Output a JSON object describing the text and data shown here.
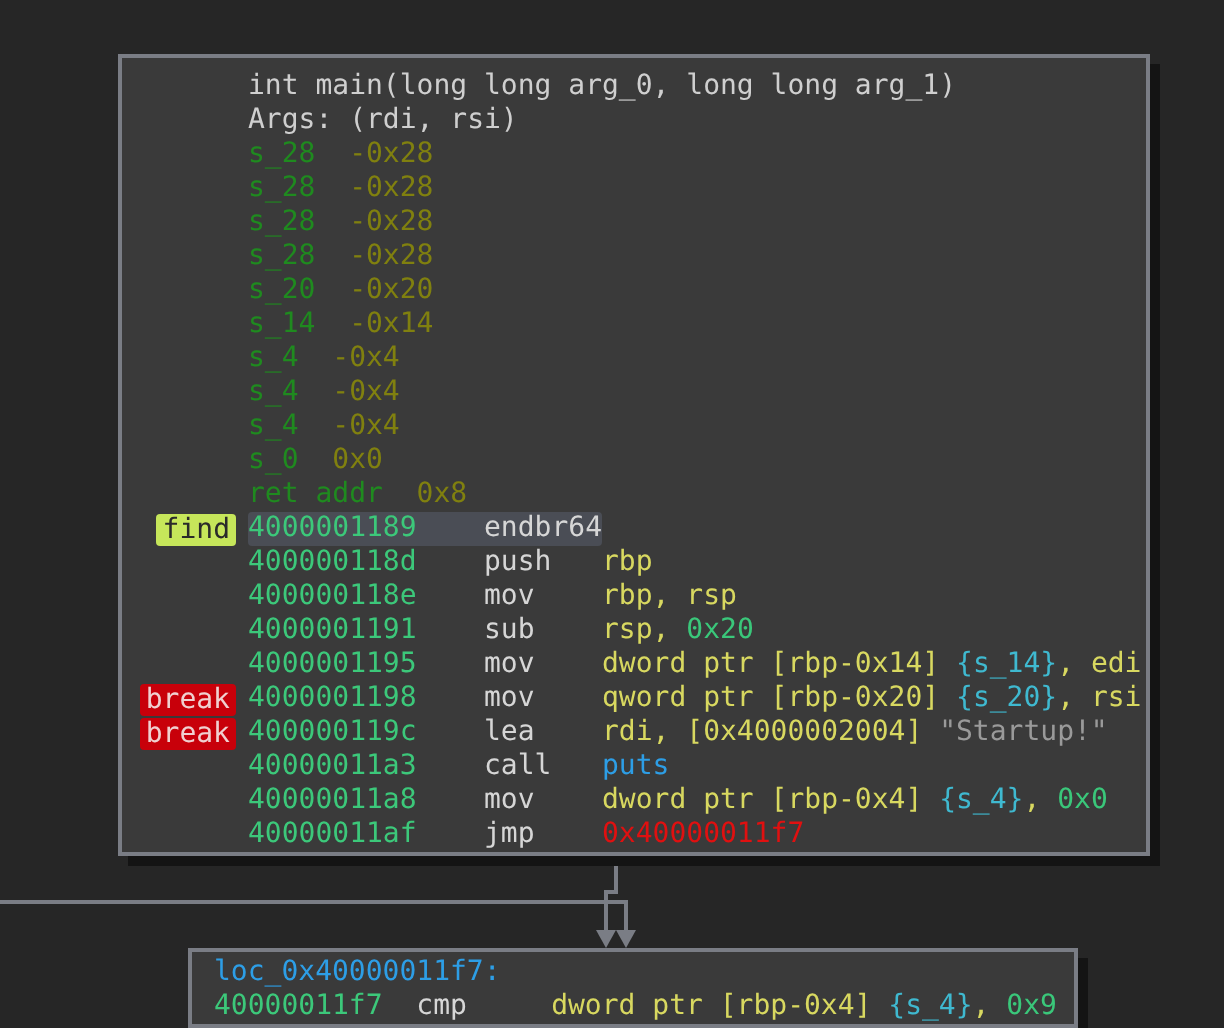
{
  "nodes": [
    {
      "header": [
        "int main(long long arg_0, long long arg_1)",
        "Args: (rdi, rsi)"
      ],
      "stack_vars": [
        {
          "name": "s_28",
          "offset": "-0x28"
        },
        {
          "name": "s_28",
          "offset": "-0x28"
        },
        {
          "name": "s_28",
          "offset": "-0x28"
        },
        {
          "name": "s_28",
          "offset": "-0x28"
        },
        {
          "name": "s_20",
          "offset": "-0x20"
        },
        {
          "name": "s_14",
          "offset": "-0x14"
        },
        {
          "name": "s_4",
          "offset": "-0x4"
        },
        {
          "name": "s_4",
          "offset": "-0x4"
        },
        {
          "name": "s_4",
          "offset": "-0x4"
        },
        {
          "name": "s_0",
          "offset": "0x0"
        },
        {
          "name": "ret addr",
          "offset": "0x8"
        }
      ],
      "instructions": [
        {
          "address": "4000001189",
          "mnemonic": "endbr64",
          "selected": true,
          "tag": {
            "text": "find",
            "kind": "find"
          }
        },
        {
          "address": "400000118d",
          "mnemonic": "push",
          "selected": false,
          "operands": [
            {
              "text": "rbp",
              "kind": "reg"
            }
          ]
        },
        {
          "address": "400000118e",
          "mnemonic": "mov",
          "selected": false,
          "operands": [
            {
              "text": "rbp, rsp",
              "kind": "reg"
            }
          ]
        },
        {
          "address": "4000001191",
          "mnemonic": "sub",
          "selected": false,
          "operands": [
            {
              "text": "rsp, ",
              "kind": "reg"
            },
            {
              "text": "0x20",
              "kind": "imm"
            }
          ]
        },
        {
          "address": "4000001195",
          "mnemonic": "mov",
          "selected": false,
          "operands": [
            {
              "text": "dword ptr [rbp-0x14] ",
              "kind": "reg"
            },
            {
              "text": "{s_14}",
              "kind": "var"
            },
            {
              "text": ", edi",
              "kind": "reg"
            }
          ]
        },
        {
          "address": "4000001198",
          "mnemonic": "mov",
          "selected": false,
          "tag": {
            "text": "break",
            "kind": "break"
          },
          "operands": [
            {
              "text": "qword ptr [rbp-0x20] ",
              "kind": "reg"
            },
            {
              "text": "{s_20}",
              "kind": "var"
            },
            {
              "text": ", rsi",
              "kind": "reg"
            }
          ]
        },
        {
          "address": "400000119c",
          "mnemonic": "lea",
          "selected": false,
          "tag": {
            "text": "break",
            "kind": "break"
          },
          "operands": [
            {
              "text": "rdi, [0x4000002004] ",
              "kind": "reg"
            },
            {
              "text": "\"Startup!\"",
              "kind": "str"
            }
          ]
        },
        {
          "address": "40000011a3",
          "mnemonic": "call",
          "selected": false,
          "operands": [
            {
              "text": "puts",
              "kind": "call"
            }
          ]
        },
        {
          "address": "40000011a8",
          "mnemonic": "mov",
          "selected": false,
          "operands": [
            {
              "text": "dword ptr [rbp-0x4] ",
              "kind": "reg"
            },
            {
              "text": "{s_4}",
              "kind": "var"
            },
            {
              "text": ", ",
              "kind": "reg"
            },
            {
              "text": "0x0",
              "kind": "imm"
            }
          ]
        },
        {
          "address": "40000011af",
          "mnemonic": "jmp",
          "selected": false,
          "operands": [
            {
              "text": "0x40000011f7",
              "kind": "addr"
            }
          ]
        }
      ]
    },
    {
      "label": "loc_0x40000011f7:",
      "instructions": [
        {
          "address": "40000011f7",
          "mnemonic": "cmp",
          "selected": false,
          "operands": [
            {
              "text": "dword ptr [rbp-0x4] ",
              "kind": "reg"
            },
            {
              "text": "{s_4}",
              "kind": "var"
            },
            {
              "text": ", ",
              "kind": "reg"
            },
            {
              "text": "0x9",
              "kind": "imm"
            }
          ]
        }
      ]
    }
  ]
}
